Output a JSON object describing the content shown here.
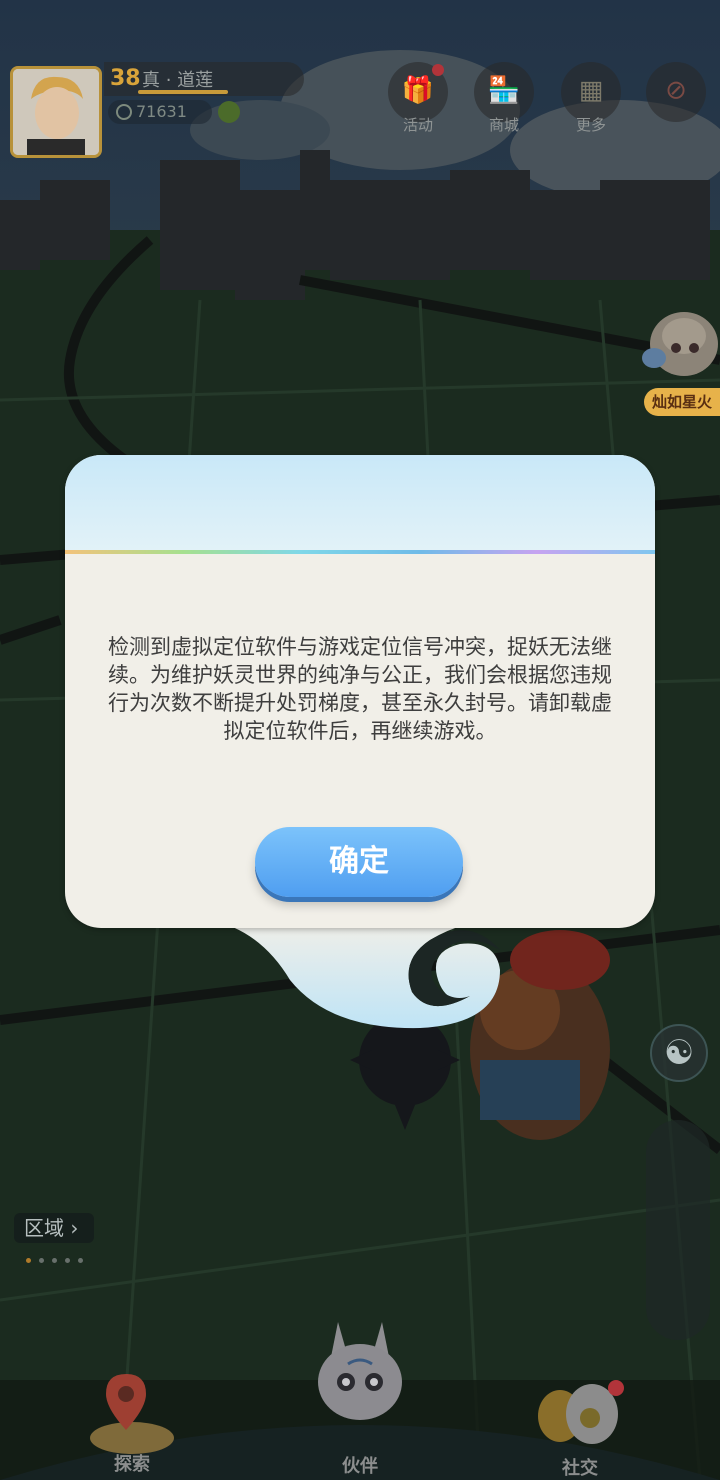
{
  "player": {
    "level": "38",
    "name": "真 · 道莲",
    "coins": "71631"
  },
  "top_menu": [
    {
      "label": "活动",
      "icon": "gift-icon",
      "badge": true
    },
    {
      "label": "商城",
      "icon": "shop-icon",
      "badge": false
    },
    {
      "label": "更多",
      "icon": "more-icon",
      "badge": false
    },
    {
      "label": "",
      "icon": "compass-lock-icon",
      "badge": false
    }
  ],
  "event_banner": {
    "label": "灿如星火"
  },
  "region_button": {
    "label": "区域"
  },
  "dialog": {
    "message": "检测到虚拟定位软件与游戏定位信号冲突，捉妖无法继续。为维护妖灵世界的纯净与公正，我们会根据您违规行为次数不断提升处罚梯度，甚至永久封号。请卸载虚拟定位软件后，再继续游戏。",
    "ok_label": "确定"
  },
  "bottom_nav": [
    {
      "label": "探索",
      "icon": "map-pin-icon"
    },
    {
      "label": "伙伴",
      "icon": "spirit-icon"
    },
    {
      "label": "社交",
      "icon": "social-icon",
      "badge": true
    }
  ],
  "colors": {
    "dialog_bg": "#f1efe8",
    "button_blue": "#5aa8f4",
    "accent_gold": "#d9a43a",
    "badge_red": "#b2343a"
  }
}
